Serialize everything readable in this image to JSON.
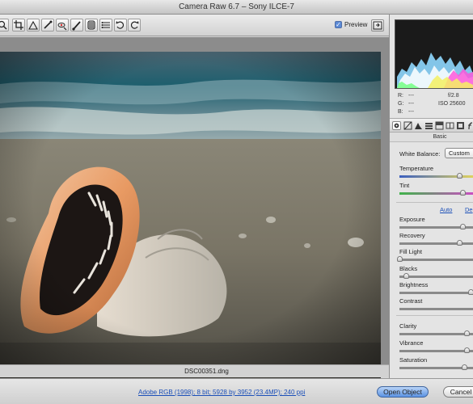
{
  "window": {
    "title": "Camera Raw 6.7  –  Sony ILCE-7"
  },
  "toolbar": {
    "tools": [
      "zoom-icon",
      "crop-icon",
      "straighten-icon",
      "spot-removal-icon",
      "red-eye-icon",
      "adjustment-brush-icon",
      "graduated-filter-icon",
      "preferences-icon",
      "rotate-ccw-icon",
      "rotate-cw-icon"
    ],
    "preview_label": "Preview",
    "preview_checked": true
  },
  "image": {
    "filename": "DSC00351.dng"
  },
  "info": {
    "r_label": "R:",
    "r_value": "---",
    "g_label": "G:",
    "g_value": "---",
    "b_label": "B:",
    "b_value": "---",
    "aperture": "f/2.8",
    "iso": "ISO 25600"
  },
  "panel_tabs": [
    "basic-icon",
    "tone-curve-icon",
    "detail-icon",
    "hsl-icon",
    "split-tone-icon",
    "lens-icon",
    "effects-icon",
    "fx-icon"
  ],
  "basic": {
    "section_title": "Basic",
    "white_balance_label": "White Balance:",
    "white_balance_value": "Custom",
    "auto_label": "Auto",
    "default_label": "De",
    "sliders": {
      "temperature": {
        "label": "Temperature",
        "level": 0.77
      },
      "tint": {
        "label": "Tint",
        "level": 0.81
      },
      "exposure": {
        "label": "Exposure",
        "level": 0.81
      },
      "recovery": {
        "label": "Recovery",
        "level": 0.77
      },
      "fill_light": {
        "label": "Fill Light",
        "level": 0.0
      },
      "blacks": {
        "label": "Blacks",
        "level": 0.08
      },
      "brightness": {
        "label": "Brightness",
        "level": 0.92
      },
      "contrast": {
        "label": "Contrast",
        "level": 1.0
      },
      "clarity": {
        "label": "Clarity",
        "level": 0.86
      },
      "vibrance": {
        "label": "Vibrance",
        "level": 0.86
      },
      "saturation": {
        "label": "Saturation",
        "level": 0.83
      }
    }
  },
  "footer": {
    "workflow_link": "Adobe RGB (1998); 8 bit; 5928 by 3952 (23.4MP); 240 ppi",
    "open_object_label": "Open Object",
    "cancel_label": "Cancel"
  },
  "colors": {
    "accent": "#5b93e3",
    "link": "#1b4fb8"
  }
}
